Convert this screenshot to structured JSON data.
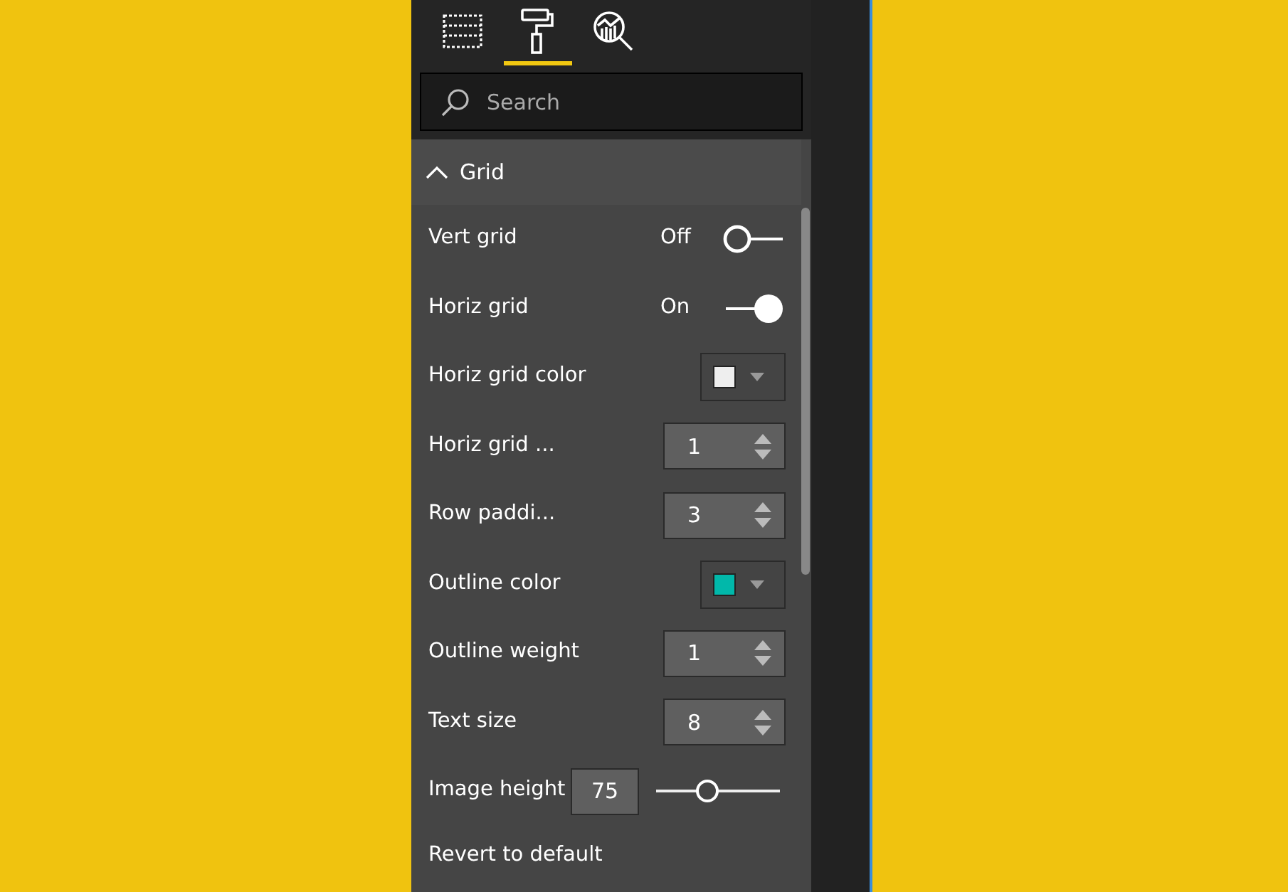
{
  "tabs": [
    {
      "selected": false
    },
    {
      "selected": true
    },
    {
      "selected": false
    }
  ],
  "search": {
    "placeholder": "Search"
  },
  "section": {
    "title": "Grid",
    "expanded": true
  },
  "settings": [
    {
      "kind": "toggle",
      "label": "Vert grid",
      "state_text": "Off",
      "on": false
    },
    {
      "kind": "toggle",
      "label": "Horiz grid",
      "state_text": "On",
      "on": true
    },
    {
      "kind": "color",
      "label": "Horiz grid color",
      "color": "#eeeeee"
    },
    {
      "kind": "spinner",
      "label": "Horiz grid ...",
      "value": "1"
    },
    {
      "kind": "spinner",
      "label": "Row paddi...",
      "value": "3"
    },
    {
      "kind": "color",
      "label": "Outline color",
      "color": "#01b8aa"
    },
    {
      "kind": "spinner",
      "label": "Outline weight",
      "value": "1"
    },
    {
      "kind": "spinner",
      "label": "Text size",
      "value": "8"
    },
    {
      "kind": "slider",
      "label": "Image height",
      "value": "75",
      "level": 0.41
    }
  ],
  "revert": "Revert to default"
}
